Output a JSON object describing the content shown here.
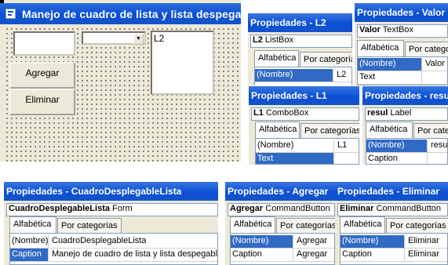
{
  "form": {
    "title": "Manejo de cuadro de lista y lista despegable",
    "add_button": "Agregar",
    "remove_button": "Eliminar",
    "textbox_value": "",
    "combo_value": "",
    "combo_arrow": "▼",
    "listbox_item": "L2"
  },
  "colors": {
    "title_bar": "#0a4fd6",
    "selection": "#316ac5",
    "face": "#ece9d8"
  },
  "tabs": {
    "alphabetic": "Alfabética",
    "categories": "Por categorías"
  },
  "props": {
    "name_key": "(Nombre)",
    "text_key": "Text",
    "caption_key": "Caption",
    "form_caption_value": "Manejo de cuadro de lista y lista despegable"
  },
  "windows": [
    {
      "title": "Propiedades - L2",
      "object": "L2",
      "type": "ListBox",
      "row1": "L2",
      "row2": ""
    },
    {
      "title": "Propiedades - Valor",
      "object": "Valor",
      "type": "TextBox",
      "row1": "Valor",
      "row2": ""
    },
    {
      "title": "Propiedades - L1",
      "object": "L1",
      "type": "ComboBox",
      "row1": "L1",
      "row2": ""
    },
    {
      "title": "Propiedades - resul",
      "object": "resul",
      "type": "Label",
      "row1": "resul",
      "row2": ""
    },
    {
      "title": "Propiedades - CuadroDesplegableLista",
      "object": "CuadroDesplegableLista",
      "type": "Form",
      "row1": "CuadroDesplegableLista",
      "row2": "Manejo de cuadro de lista y lista despegable"
    },
    {
      "title": "Propiedades - Agregar",
      "object": "Agregar",
      "type": "CommandButton",
      "row1": "Agregar",
      "row2": "Agregar"
    },
    {
      "title": "Propiedades - Eliminar",
      "object": "Eliminar",
      "type": "CommandButton",
      "row1": "Eliminar",
      "row2": "Eliminar"
    }
  ]
}
